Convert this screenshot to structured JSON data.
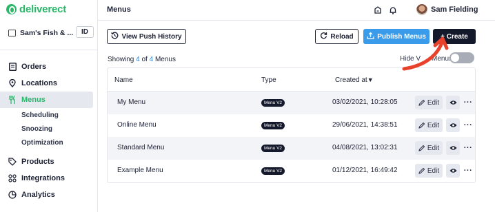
{
  "app": {
    "brand": "deliverect",
    "brand_color": "#2ab76a",
    "accent_color": "#3a9bea"
  },
  "sidebar": {
    "store_name": "Sam's Fish & ...",
    "store_id": "ID",
    "items": [
      {
        "label": "Orders",
        "icon": "orders-icon"
      },
      {
        "label": "Locations",
        "icon": "location-pin-icon"
      },
      {
        "label": "Menus",
        "icon": "cutlery-icon",
        "active": true
      },
      {
        "label": "Products",
        "icon": "tag-icon"
      },
      {
        "label": "Integrations",
        "icon": "integrations-icon"
      },
      {
        "label": "Analytics",
        "icon": "analytics-icon"
      }
    ],
    "sub_items": [
      "Scheduling",
      "Snoozing",
      "Optimization"
    ]
  },
  "header": {
    "title": "Menus",
    "user_name": "Sam Fielding"
  },
  "toolbar": {
    "push_history_label": "View Push History",
    "reload_label": "Reload",
    "publish_label": "Publish Menus",
    "create_label": "+ Create"
  },
  "summary": {
    "prefix": "Showing ",
    "shown": "4",
    "of": " of ",
    "total": "4",
    "suffix": " Menus"
  },
  "hide_toggle": {
    "label": "Hide V",
    "label_tail": "Menus",
    "on": false
  },
  "table": {
    "headers": {
      "name": "Name",
      "type": "Type",
      "created": "Created at",
      "sort_indicator": "▼"
    },
    "rows": [
      {
        "name": "My Menu",
        "type": "Menu V2",
        "created": "03/02/2021, 10:28:05"
      },
      {
        "name": "Online Menu",
        "type": "Menu V2",
        "created": "29/06/2021, 14:38:51"
      },
      {
        "name": "Standard Menu",
        "type": "Menu V2",
        "created": "04/08/2021, 13:02:31"
      },
      {
        "name": "Example Menu",
        "type": "Menu V2",
        "created": "01/12/2021, 16:49:42"
      }
    ],
    "edit_label": "Edit",
    "more_label": "···"
  }
}
